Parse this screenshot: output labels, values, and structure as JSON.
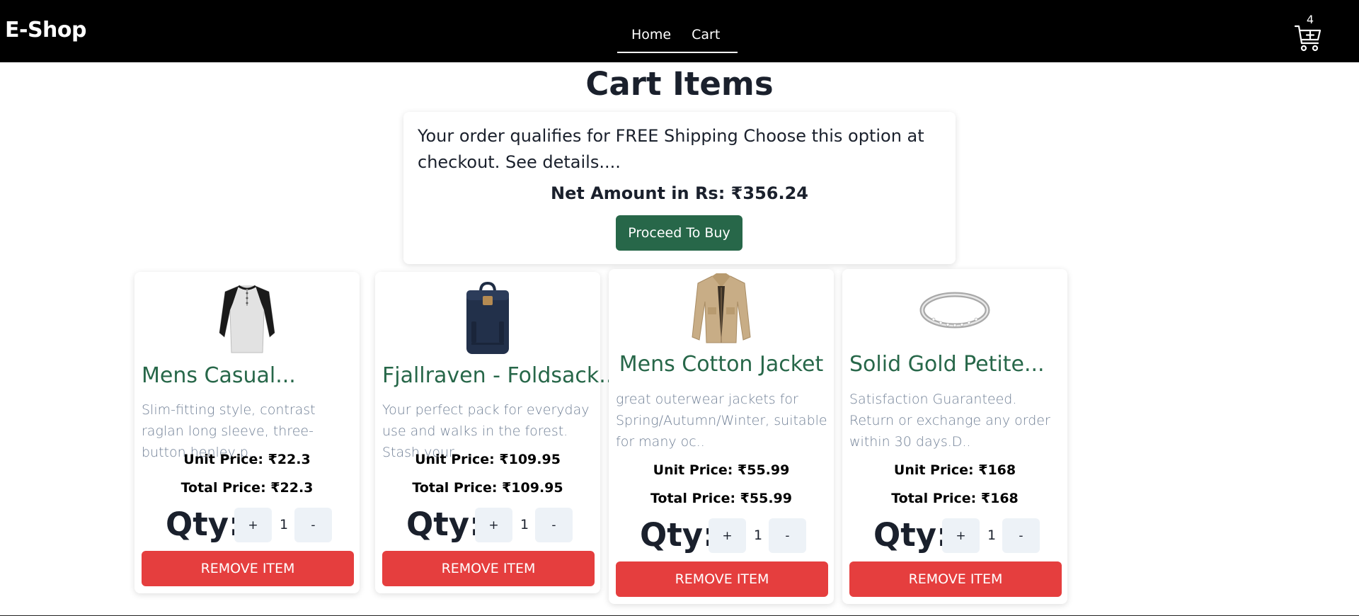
{
  "header": {
    "brand": "E-Shop",
    "nav": [
      {
        "label": "Home"
      },
      {
        "label": "Cart"
      }
    ],
    "cart_count": "4",
    "cart_icon": "cart-plus-icon"
  },
  "page": {
    "title": "Cart Items"
  },
  "summary": {
    "message": "Your order qualifies for FREE Shipping Choose this option at checkout. See details....",
    "net_amount": "Net Amount in Rs: ₹356.24",
    "buy_label": "Proceed To Buy",
    "buy_color": "#276749"
  },
  "items": [
    {
      "name": "Mens Casual...",
      "description": "Slim-fitting style, contrast raglan long sleeve, three-button henley p..",
      "unit_price": "Unit Price: ₹22.3",
      "total_price": "Total Price: ₹22.3",
      "qty_label": "Qty:",
      "qty": "1",
      "plus": "+",
      "minus": "-",
      "remove_label": "REMOVE ITEM"
    },
    {
      "name": "Fjallraven - Foldsack...",
      "description": "Your perfect pack for everyday use and walks in the forest. Stash your..",
      "unit_price": "Unit Price: ₹109.95",
      "total_price": "Total Price: ₹109.95",
      "qty_label": "Qty:",
      "qty": "1",
      "plus": "+",
      "minus": "-",
      "remove_label": "REMOVE ITEM"
    },
    {
      "name": "Mens Cotton Jacket",
      "description": "great outerwear jackets for Spring/Autumn/Winter, suitable for many oc..",
      "unit_price": "Unit Price: ₹55.99",
      "total_price": "Total Price: ₹55.99",
      "qty_label": "Qty:",
      "qty": "1",
      "plus": "+",
      "minus": "-",
      "remove_label": "REMOVE ITEM"
    },
    {
      "name": "Solid Gold Petite...",
      "description": "Satisfaction Guaranteed. Return or exchange any order within 30 days.D..",
      "unit_price": "Unit Price: ₹168",
      "total_price": "Total Price: ₹168",
      "qty_label": "Qty:",
      "qty": "1",
      "plus": "+",
      "minus": "-",
      "remove_label": "REMOVE ITEM"
    }
  ],
  "colors": {
    "navbar": "#000000",
    "accent_green": "#276749",
    "remove_red": "#e53e3e",
    "qty_button": "#edf2f7"
  }
}
